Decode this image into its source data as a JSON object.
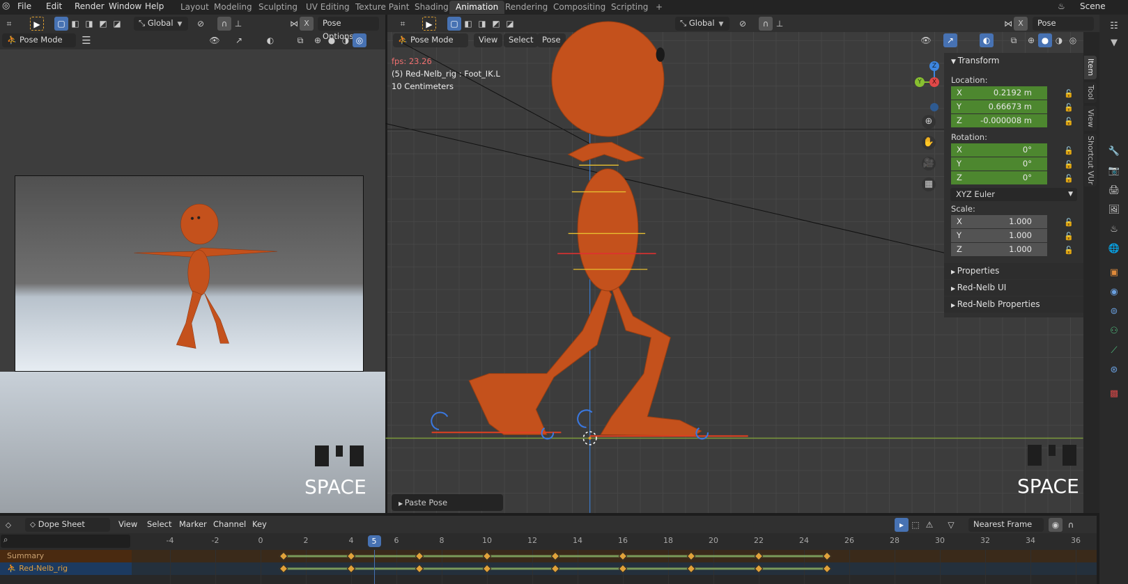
{
  "menu": [
    "File",
    "Edit",
    "Render",
    "Window",
    "Help"
  ],
  "workspaces": [
    "Layout",
    "Modeling",
    "Sculpting",
    "UV Editing",
    "Texture Paint",
    "Shading",
    "Animation",
    "Rendering",
    "Compositing",
    "Scripting",
    "+"
  ],
  "active_workspace": "Animation",
  "scene": "Scene",
  "left_viewport": {
    "orientation": "Global",
    "x_label": "X",
    "pose_options": "Pose Options",
    "mode": "Pose Mode",
    "overlay_key": "SPACE"
  },
  "main_viewport": {
    "orientation": "Global",
    "x_label": "X",
    "pose_options": "Pose Options",
    "mode": "Pose Mode",
    "menus": [
      "View",
      "Select",
      "Pose"
    ],
    "fps": "fps: 23.26",
    "info": "(5) Red-Nelb_rig : Foot_IK.L",
    "scale": "10 Centimeters",
    "last_op": "Paste Pose",
    "overlay_key": "SPACE",
    "gizmo": {
      "x": "X",
      "y": "Y",
      "z": "Z"
    }
  },
  "sidebar": {
    "title": "Transform",
    "location_label": "Location:",
    "rotation_label": "Rotation:",
    "scale_label": "Scale:",
    "location": [
      {
        "axis": "X",
        "value": "0.2192 m"
      },
      {
        "axis": "Y",
        "value": "0.66673 m"
      },
      {
        "axis": "Z",
        "value": "-0.000008 m"
      }
    ],
    "rotation": [
      {
        "axis": "X",
        "value": "0°"
      },
      {
        "axis": "Y",
        "value": "0°"
      },
      {
        "axis": "Z",
        "value": "0°"
      }
    ],
    "rotation_mode": "XYZ Euler",
    "scale": [
      {
        "axis": "X",
        "value": "1.000"
      },
      {
        "axis": "Y",
        "value": "1.000"
      },
      {
        "axis": "Z",
        "value": "1.000"
      }
    ],
    "panels": [
      "Properties",
      "Red-Nelb UI",
      "Red-Nelb Properties"
    ],
    "tabs": [
      "Item",
      "Tool",
      "View",
      "Shortcut VUr"
    ]
  },
  "dopesheet": {
    "mode": "Dope Sheet",
    "menus": [
      "View",
      "Select",
      "Marker",
      "Channel",
      "Key"
    ],
    "snap": "Nearest Frame",
    "current_frame": 5,
    "ticks": [
      -4,
      -2,
      0,
      2,
      4,
      6,
      8,
      10,
      12,
      14,
      16,
      18,
      20,
      22,
      24,
      26,
      28,
      30,
      32,
      34,
      36
    ],
    "channels": [
      "Summary",
      "Red-Nelb_rig"
    ],
    "keyframes": [
      1,
      4,
      7,
      10,
      13,
      16,
      19,
      22,
      25
    ]
  },
  "colors": {
    "accent": "#4772b3",
    "orange": "#c4511c",
    "green_field": "#4e8a2f",
    "key": "#e1a23a"
  }
}
